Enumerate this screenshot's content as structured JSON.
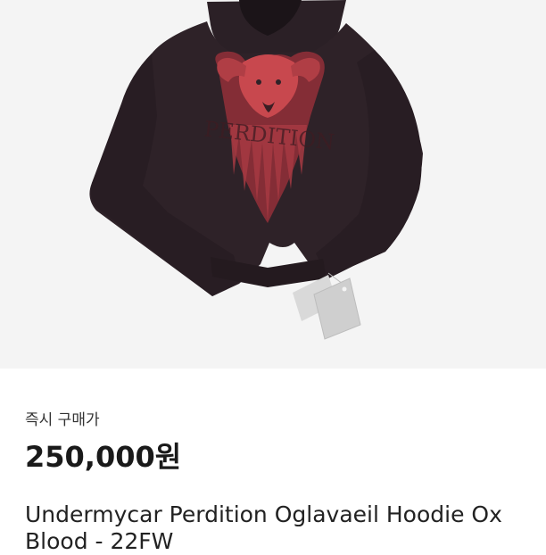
{
  "product": {
    "image_subject": "hoodie-photo",
    "price_label": "즉시 구매가",
    "price": "250,000원",
    "title_line1": "Undermycar Perdition Oglavaeil Hoodie Ox",
    "title_line2": "Blood - 22FW",
    "graphic_text": "PERDITION"
  },
  "colors": {
    "image_background": "#f4f4f4",
    "hoodie": "#2e2228",
    "graphic_red": "#c8484e"
  }
}
